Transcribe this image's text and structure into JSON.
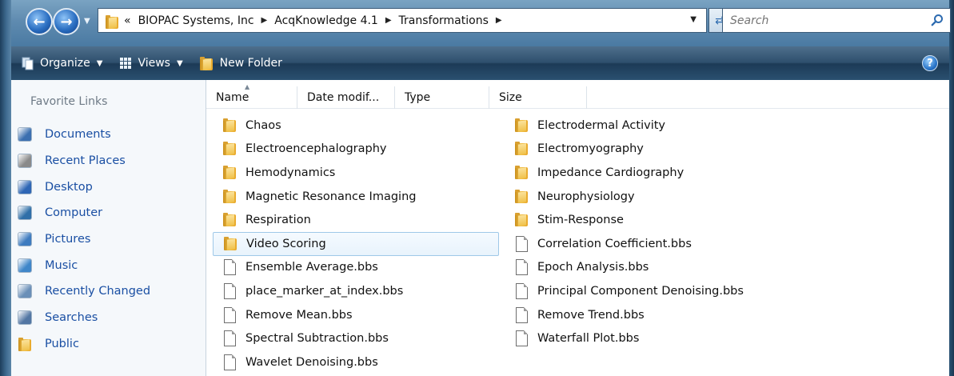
{
  "breadcrumb": {
    "overflow": "«",
    "segments": [
      "BIOPAC Systems, Inc",
      "AcqKnowledge 4.1",
      "Transformations"
    ]
  },
  "search": {
    "placeholder": "Search"
  },
  "toolbar": {
    "organize": "Organize",
    "views": "Views",
    "new_folder": "New Folder",
    "help": "?"
  },
  "navpane": {
    "title": "Favorite Links",
    "items": [
      {
        "label": "Documents",
        "icon": "documents-icon"
      },
      {
        "label": "Recent Places",
        "icon": "recent-places-icon"
      },
      {
        "label": "Desktop",
        "icon": "desktop-icon"
      },
      {
        "label": "Computer",
        "icon": "computer-icon"
      },
      {
        "label": "Pictures",
        "icon": "pictures-icon"
      },
      {
        "label": "Music",
        "icon": "music-icon"
      },
      {
        "label": "Recently Changed",
        "icon": "recently-changed-icon"
      },
      {
        "label": "Searches",
        "icon": "searches-icon"
      },
      {
        "label": "Public",
        "icon": "folder-icon"
      }
    ]
  },
  "columns": [
    "Name",
    "Date modif...",
    "Type",
    "Size"
  ],
  "files_col1": [
    {
      "name": "Chaos",
      "kind": "folder"
    },
    {
      "name": "Electroencephalography",
      "kind": "folder"
    },
    {
      "name": "Hemodynamics",
      "kind": "folder"
    },
    {
      "name": "Magnetic Resonance Imaging",
      "kind": "folder"
    },
    {
      "name": "Respiration",
      "kind": "folder"
    },
    {
      "name": "Video Scoring",
      "kind": "folder",
      "selected": true
    },
    {
      "name": "Ensemble Average.bbs",
      "kind": "file"
    },
    {
      "name": "place_marker_at_index.bbs",
      "kind": "file"
    },
    {
      "name": "Remove Mean.bbs",
      "kind": "file"
    },
    {
      "name": "Spectral Subtraction.bbs",
      "kind": "file"
    },
    {
      "name": "Wavelet Denoising.bbs",
      "kind": "file"
    }
  ],
  "files_col2": [
    {
      "name": "Electrodermal Activity",
      "kind": "folder"
    },
    {
      "name": "Electromyography",
      "kind": "folder"
    },
    {
      "name": "Impedance Cardiography",
      "kind": "folder"
    },
    {
      "name": "Neurophysiology",
      "kind": "folder"
    },
    {
      "name": "Stim-Response",
      "kind": "folder"
    },
    {
      "name": "Correlation Coefficient.bbs",
      "kind": "file"
    },
    {
      "name": "Epoch Analysis.bbs",
      "kind": "file"
    },
    {
      "name": "Principal Component Denoising.bbs",
      "kind": "file"
    },
    {
      "name": "Remove Trend.bbs",
      "kind": "file"
    },
    {
      "name": "Waterfall Plot.bbs",
      "kind": "file"
    }
  ]
}
